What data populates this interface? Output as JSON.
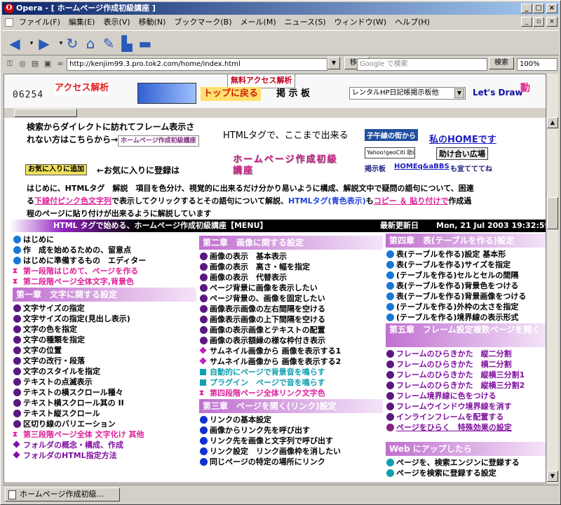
{
  "window": {
    "title": "Opera - [ ホームページ作成初級講座 ]",
    "app_icon": "O",
    "min": "_",
    "max": "□",
    "close": "×",
    "mdi_min": "_",
    "mdi_max": "▫",
    "mdi_close": "×"
  },
  "menu": [
    "ファイル(F)",
    "編集(E)",
    "表示(V)",
    "移動(N)",
    "ブックマーク(B)",
    "メール(M)",
    "ニュース(S)",
    "ウィンドウ(W)",
    "ヘルプ(H)"
  ],
  "address": {
    "url": "http://kenjim99.3.pro.tok2.com/home/index.html",
    "go": "移動",
    "search_placeholder": "Google で検索",
    "search_button": "検索",
    "zoom": "100%"
  },
  "topframe": {
    "counter": "06254",
    "banner1": "アクセス解析",
    "banner2": "無料アクセス解析",
    "banner3": "トップに戻る",
    "banner4": "掲 示 板",
    "select": "レンタルHP日記帳掲示板他",
    "banner5": "Let's Draw",
    "banner6": "動"
  },
  "intro": {
    "line1": "検索からダイレクトに訪れてフレーム表示さ",
    "line2": "れない方はこちらから→",
    "logo1": "ホームページ作成初級講座",
    "fav_button": "お気に入りに追加",
    "fav_text": "←お気に入りに登録は",
    "html_tag": "HTMLタグで、ここまで出来る",
    "logo2": "ホームページ作成初級講座",
    "badge1": "子午線の街から",
    "myhome": "私のHOMEです",
    "badge2": "Yahoo!geoCiti 助け合い広場",
    "help_plaza": "助け合い広場",
    "bbs_label": "掲示板",
    "bbs_link": "HOMEq&aBBS",
    "bbs_tail": "も宜てててね"
  },
  "blurb": {
    "p1": "はじめに、HTMLタグ　解説　項目を色分け、視覚的に出来るだけ分かり易いように構成、解説文中で疑問の語句について、困連",
    "p2a": "る",
    "p2b": "下線付ピンク色文字列",
    "p2c": "で表示してクリックするとその語句について解説、",
    "p2d": "HTMLタグ(青色表示)",
    "p2e": "も",
    "p2f": "コピー ＆ 貼り付けで",
    "p2g": "作成過",
    "p3": "程のページに貼り付けが出来るように解説しています"
  },
  "menu_header": {
    "title": "HTML タグで始める、ホームページ作成初級講座【MENU】",
    "update_label": "最新更新日",
    "update": "Mon, 21 Jul 2003 19:32:59 GMT"
  },
  "col1": {
    "items": [
      "はじめに",
      "作　成を始めるための、留意点",
      "はじめに準備するもの　エディター"
    ],
    "links": [
      "第一段階はじめて、ページを作る",
      "第二段階ページ全体文字,背景色"
    ],
    "ch1": "第一章　文字に関する設定",
    "ch1_items": [
      "文字サイズの指定",
      "文字サイズの指定(見出し表示)",
      "文字の色を指定",
      "文字の種類を指定",
      "文字の位置",
      "文字の改行・段落",
      "文字のスタイルを指定",
      "テキストの点滅表示",
      "テキストの横スクロール種々",
      "テキスト横スクロール其の II",
      "テキスト縦スクロール",
      "区切り線のバリエーション"
    ],
    "after": [
      "第三段階ページ全体 文字化け 其他",
      "フォルダの概念・構成、作成",
      "フォルダのHTML指定方法"
    ]
  },
  "col2": {
    "ch2": "第二章　画像に関する設定",
    "ch2_items": [
      "画像の表示　基本表示",
      "画像の表示　高さ・幅を指定",
      "画像の表示　代替表示",
      "ページ背景に画像を表示したい",
      "ページ背景の、画像を固定したい",
      "画像表示画像の左右間隔を空ける",
      "画像表示画像の上下間隔を空ける",
      "画像の表示画像とテキストの配置",
      "画像の表示額縁の様な枠付き表示"
    ],
    "thumbs": [
      "サムネイル画像から 画像を表示する1",
      "サムネイル画像から 画像を表示する2"
    ],
    "teal": [
      "自動的にページで背景音を鳴らす",
      "プラグイン　ページで音を鳴らす"
    ],
    "stage4": "第四段階ページ全体リンク文字色",
    "ch3": "第三章　ページを開く(リンク)設定",
    "ch3_items": [
      "リンクの基本設定",
      "画像からリンク先を呼び出す",
      "リンク先を画像と文字列で呼び出す",
      "リンク設定　リンク画像枠を消したい",
      "同じページの特定の場所にリンク"
    ]
  },
  "col3": {
    "ch4": "第四章　表(テーブルを作る)設定",
    "ch4_items": [
      "表(テーブルを作る)設定 基本形",
      "表(テーブルを作る)サイズを指定",
      "(テーブルを作る)セルとセルの間隔",
      "表(テーブルを作る)背景色をつける",
      "表(テーブルを作る)背景画像をつける",
      "(テーブルを作る)外枠の太さを指定",
      "(テーブルを作る)境界線の表示形式"
    ],
    "ch5": "第五章　フレーム設定複数ページを開く",
    "ch5_items": [
      "フレームのひらきかた　縦二分割",
      "フレームのひらきかた　横二分割",
      "フレームのひらきかた　縦横三分割1",
      "フレームのひらきかた　縦横三分割2",
      "フレーム境界線に色をつける",
      "フレームウインドウ境界線を消す",
      "インラインフレームを配置する"
    ],
    "ch5_link": "ページをひらく　特殊効果の設定",
    "web": "Web にアップしたら",
    "web_items": [
      "ページを、検索エンジンに登録する",
      "ページを検索に登録する設定"
    ]
  },
  "status": {
    "tab": "ホームページ作成初級..."
  },
  "colors": {
    "pink": "#e0209a",
    "blue": "#0a246a",
    "purple": "#9020c0",
    "dot_blue": "#1878d8",
    "dot_violet": "#5a1880"
  }
}
